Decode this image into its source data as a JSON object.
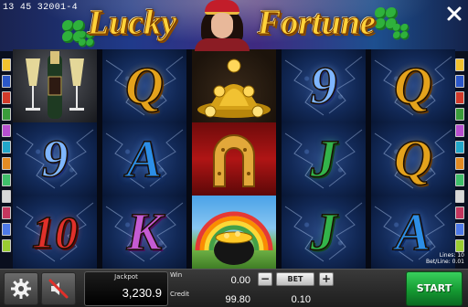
{
  "header": {
    "status_line": "13 45  32001-4",
    "logo_left": "Lucky",
    "logo_right": "Fortune",
    "close_icon": "close-icon"
  },
  "markers": {
    "left_colors": [
      "#f2c12e",
      "#2b57c8",
      "#d23a2a",
      "#3a9c3a",
      "#b84fd0",
      "#22a7c9",
      "#e38b23",
      "#3fbf6a",
      "#d8d8d8",
      "#c4365e",
      "#4e79e8",
      "#9acd32"
    ],
    "right_colors": [
      "#f2c12e",
      "#2b57c8",
      "#d23a2a",
      "#3a9c3a",
      "#b84fd0",
      "#22a7c9",
      "#e38b23",
      "#3fbf6a",
      "#d8d8d8",
      "#c4365e",
      "#4e79e8",
      "#9acd32"
    ]
  },
  "reels": [
    {
      "symbols": [
        "champagne",
        "9",
        "10"
      ]
    },
    {
      "symbols": [
        "Q",
        "A",
        "K"
      ]
    },
    {
      "symbols": [
        "coins",
        "horseshoe",
        "pot-of-gold"
      ]
    },
    {
      "symbols": [
        "9",
        "J",
        "J"
      ]
    },
    {
      "symbols": [
        "Q",
        "Q",
        "A"
      ]
    }
  ],
  "lines_info": {
    "lines": "Lines: 10",
    "bet_line": "Bet/Line: 0.01"
  },
  "panel": {
    "jackpot_label": "Jackpot",
    "jackpot_value": "3,230.9",
    "win_label": "Win",
    "win_value": "0.00",
    "credit_label": "Credit",
    "credit_value": "99.80",
    "bet_label": "BET",
    "bet_value": "0.10",
    "minus_label": "−",
    "plus_label": "+",
    "start_label": "START",
    "settings_icon": "gear-icon",
    "sound_icon": "speaker-muted-icon"
  },
  "colors": {
    "start_green": "#1fae42",
    "logo_gold": "#ffd23a",
    "reel_blue": "#122957"
  }
}
